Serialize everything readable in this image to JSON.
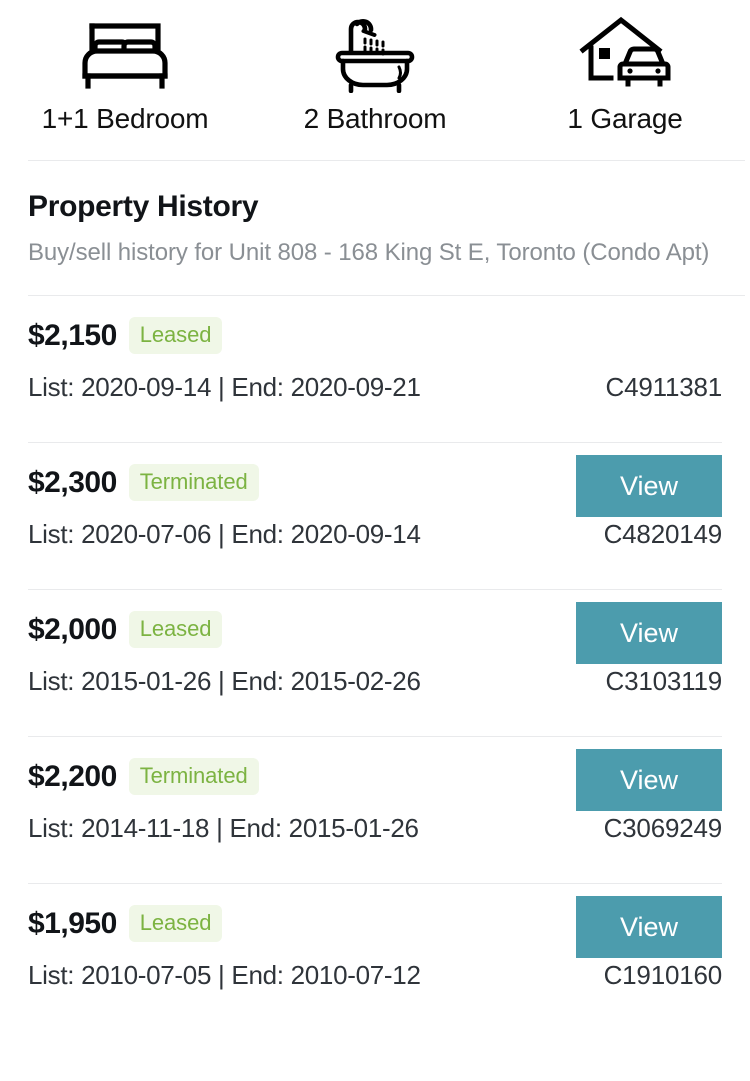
{
  "colors": {
    "accent_teal": "#4c9cad",
    "badge_bg": "#f0f7e7",
    "badge_text": "#7cb342",
    "divider": "#e9eaec",
    "text_primary": "#111418",
    "text_secondary": "#8a8f94"
  },
  "features": [
    {
      "icon": "bed-icon",
      "label": "1+1 Bedroom"
    },
    {
      "icon": "bathtub-shower-icon",
      "label": "2 Bathroom"
    },
    {
      "icon": "house-garage-car-icon",
      "label": "1 Garage"
    }
  ],
  "history": {
    "title": "Property History",
    "subtitle": "Buy/sell history for Unit 808 - 168 King St E, Toronto (Condo Apt)",
    "view_label": "View",
    "rows": [
      {
        "price": "$2,150",
        "status": "Leased",
        "dates": "List: 2020-09-14 | End: 2020-09-21",
        "mls": "C4911381",
        "has_view_button": false
      },
      {
        "price": "$2,300",
        "status": "Terminated",
        "dates": "List: 2020-07-06 | End: 2020-09-14",
        "mls": "C4820149",
        "has_view_button": true
      },
      {
        "price": "$2,000",
        "status": "Leased",
        "dates": "List: 2015-01-26 | End: 2015-02-26",
        "mls": "C3103119",
        "has_view_button": true
      },
      {
        "price": "$2,200",
        "status": "Terminated",
        "dates": "List: 2014-11-18 | End: 2015-01-26",
        "mls": "C3069249",
        "has_view_button": true
      },
      {
        "price": "$1,950",
        "status": "Leased",
        "dates": "List: 2010-07-05 | End: 2010-07-12",
        "mls": "C1910160",
        "has_view_button": true
      }
    ]
  }
}
